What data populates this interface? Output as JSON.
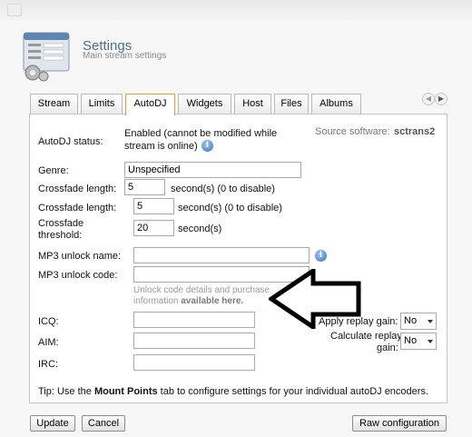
{
  "header": {
    "title": "Settings",
    "subtitle": "Main stream settings",
    "icon": "settings-window-icon"
  },
  "tabs": [
    {
      "label": "Stream",
      "active": false
    },
    {
      "label": "Limits",
      "active": false
    },
    {
      "label": "AutoDJ",
      "active": true
    },
    {
      "label": "Widgets",
      "active": false
    },
    {
      "label": "Host",
      "active": false
    },
    {
      "label": "Files",
      "active": false
    },
    {
      "label": "Albums",
      "active": false
    }
  ],
  "autodj": {
    "status_label": "AutoDJ status:",
    "status_value_line1": "Enabled (cannot be modified while",
    "status_value_line2": "stream is online)",
    "source_label": "Source software:",
    "source_value": "sctrans2",
    "genre_label": "Genre:",
    "genre_value": "Unspecified",
    "crossfade1_label": "Crossfade length:",
    "crossfade1_value": "5",
    "crossfade1_unit": "second(s) (0 to disable)",
    "crossfade2_label": "Crossfade length:",
    "crossfade2_value": "5",
    "crossfade2_unit": "second(s) (0 to disable)",
    "threshold_label_line1": "Crossfade",
    "threshold_label_line2": "threshold:",
    "threshold_value": "20",
    "threshold_unit": "second(s)",
    "mp3_name_label": "MP3 unlock name:",
    "mp3_name_value": "",
    "mp3_code_label": "MP3 unlock code:",
    "mp3_code_value": "",
    "mp3_hint_line1": "Unlock code details and purchase",
    "mp3_hint_line2_prefix": "information ",
    "mp3_hint_link": "available here.",
    "icq_label": "ICQ:",
    "icq_value": "",
    "aim_label": "AIM:",
    "aim_value": "",
    "irc_label": "IRC:",
    "irc_value": "",
    "replay_gain_label": "Apply replay gain:",
    "replay_gain_value": "No",
    "calc_replay_line1": "Calculate replay",
    "calc_replay_line2": "gain:",
    "calc_replay_value": "No",
    "tip_prefix": "Tip: Use the ",
    "tip_bold": "Mount Points",
    "tip_suffix": " tab to configure settings for your individual autoDJ encoders."
  },
  "buttons": {
    "update": "Update",
    "cancel": "Cancel",
    "raw": "Raw configuration"
  },
  "colors": {
    "title": "#4a6f96",
    "active_tab_border": "#e0a22e",
    "info_icon": "#3a76c4"
  }
}
